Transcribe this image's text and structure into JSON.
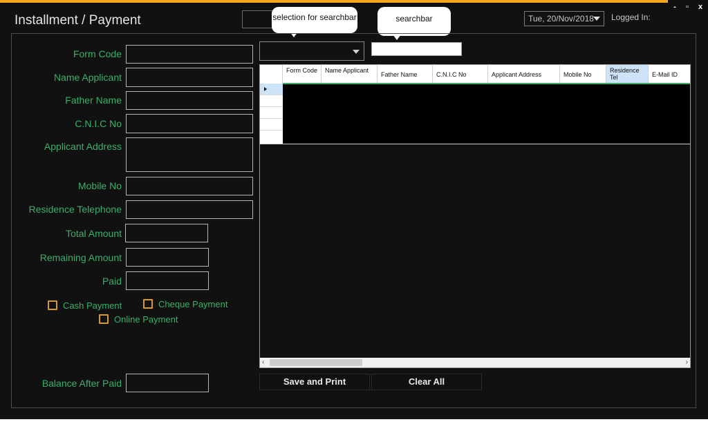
{
  "window": {
    "title": "Installment / Payment",
    "controls": {
      "minimize": "-",
      "maximize": "▫",
      "close": "x"
    },
    "date": "Tue, 20/Nov/2018",
    "logged_in_label": "Logged In:"
  },
  "annotations": {
    "selection_callout": "selection for searchbar",
    "searchbar_callout": "searchbar"
  },
  "form": {
    "form_code": "Form Code",
    "name_applicant": "Name Applicant",
    "father_name": "Father Name",
    "cnic_no": "C.N.I.C No",
    "applicant_address": "Applicant Address",
    "mobile_no": "Mobile No",
    "residence_telephone": "Residence Telephone",
    "total_amount": "Total Amount",
    "remaining_amount": "Remaining Amount",
    "paid": "Paid",
    "balance_after_paid": "Balance After Paid"
  },
  "payment_options": {
    "cash": "Cash Payment",
    "cheque": "Cheque Payment",
    "online": "Online Payment"
  },
  "grid": {
    "columns": [
      "Form Code",
      "Name Applicant",
      "Father Name",
      "C.N.I.C No",
      "Applicant Address",
      "Mobile No",
      "Residence Tel",
      "E-Mail ID"
    ]
  },
  "buttons": {
    "save_print": "Save and Print",
    "clear_all": "Clear All"
  },
  "colors": {
    "accent_orange": "#f5a623",
    "label_green": "#3bb06b",
    "background": "#111111"
  }
}
